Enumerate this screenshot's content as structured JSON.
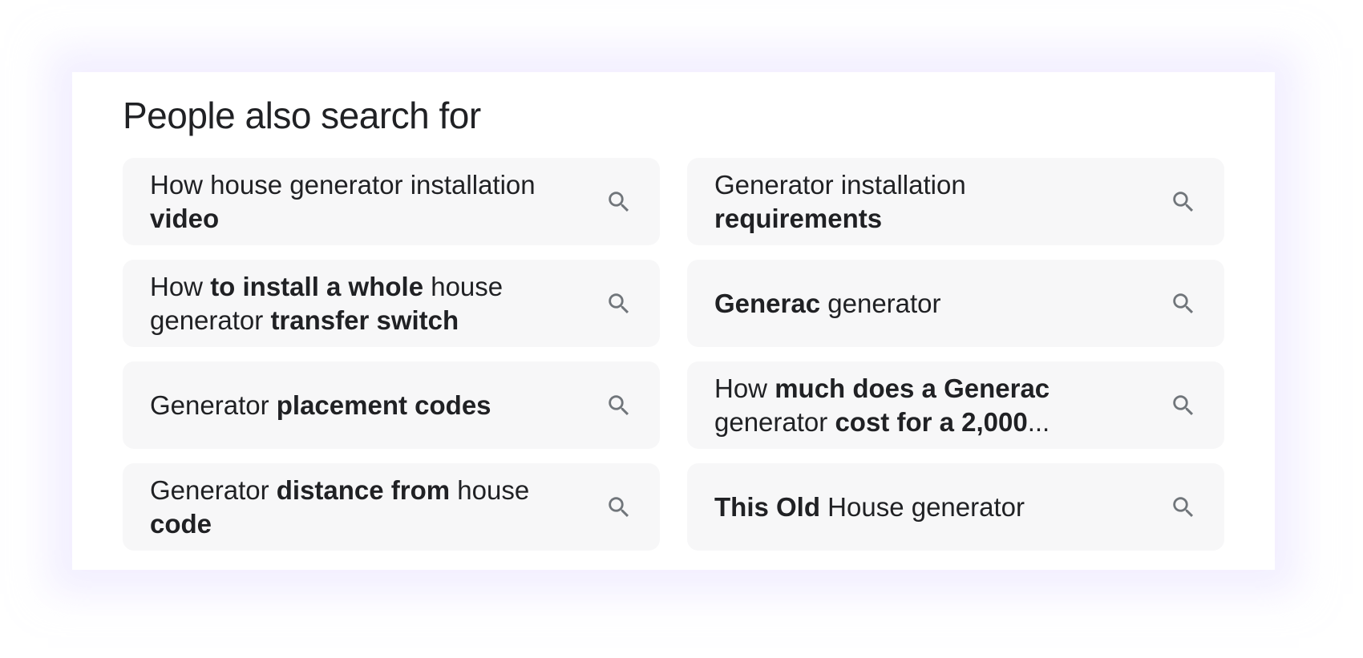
{
  "section": {
    "title": "People also search for"
  },
  "chips": [
    {
      "id": "chip-1",
      "parts": [
        {
          "text": "How house generator installation ",
          "bold": false
        },
        {
          "text": "video",
          "bold": true
        }
      ],
      "icon": "search-icon"
    },
    {
      "id": "chip-2",
      "parts": [
        {
          "text": "Generator installation ",
          "bold": false
        },
        {
          "text": "requirements",
          "bold": true
        }
      ],
      "icon": "search-icon"
    },
    {
      "id": "chip-3",
      "parts": [
        {
          "text": "How ",
          "bold": false
        },
        {
          "text": "to install a whole",
          "bold": true
        },
        {
          "text": " house generator ",
          "bold": false
        },
        {
          "text": "transfer switch",
          "bold": true
        }
      ],
      "icon": "search-icon"
    },
    {
      "id": "chip-4",
      "parts": [
        {
          "text": "Generac",
          "bold": true
        },
        {
          "text": " generator",
          "bold": false
        }
      ],
      "icon": "search-icon"
    },
    {
      "id": "chip-5",
      "parts": [
        {
          "text": "Generator ",
          "bold": false
        },
        {
          "text": "placement codes",
          "bold": true
        }
      ],
      "icon": "search-icon"
    },
    {
      "id": "chip-6",
      "parts": [
        {
          "text": "How ",
          "bold": false
        },
        {
          "text": "much does a Generac",
          "bold": true
        },
        {
          "text": " generator ",
          "bold": false
        },
        {
          "text": "cost for a 2,000",
          "bold": true
        },
        {
          "text": "...",
          "bold": false
        }
      ],
      "icon": "search-icon"
    },
    {
      "id": "chip-7",
      "parts": [
        {
          "text": "Generator ",
          "bold": false
        },
        {
          "text": "distance from",
          "bold": true
        },
        {
          "text": " house ",
          "bold": false
        },
        {
          "text": "code",
          "bold": true
        }
      ],
      "icon": "search-icon"
    },
    {
      "id": "chip-8",
      "parts": [
        {
          "text": "This Old",
          "bold": true
        },
        {
          "text": " House generator",
          "bold": false
        }
      ],
      "icon": "search-icon"
    }
  ],
  "colors": {
    "text": "#202124",
    "chip_background": "#f7f7f8",
    "icon": "#70757a",
    "glow": "#e8e2ff"
  }
}
